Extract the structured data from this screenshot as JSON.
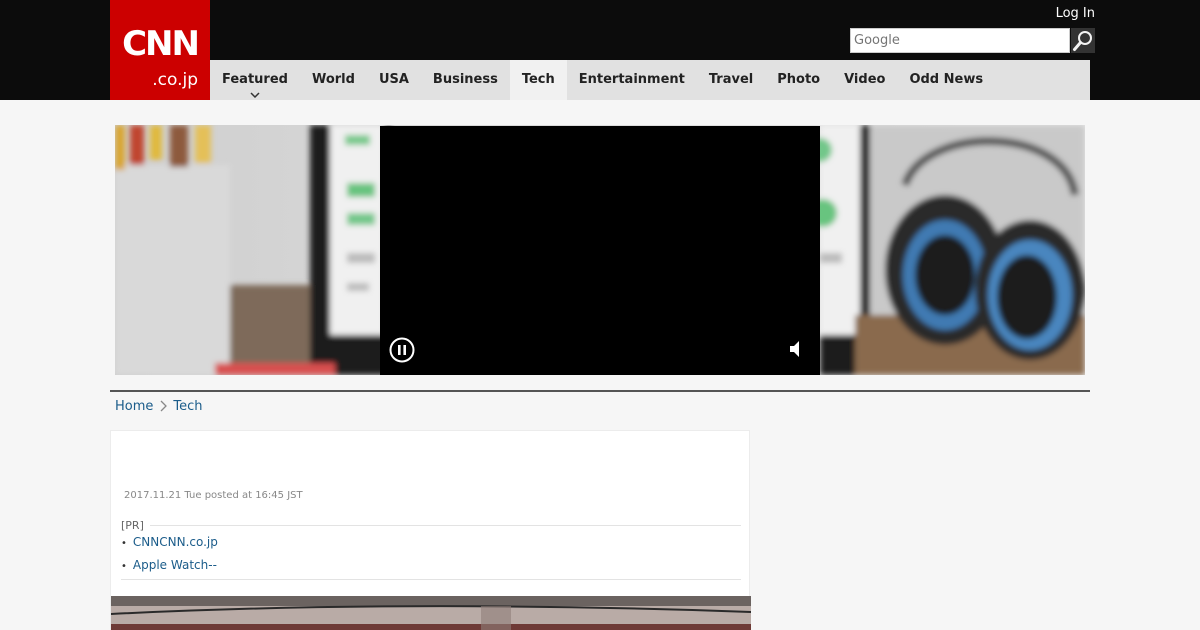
{
  "site": {
    "logo_main": "CNN",
    "logo_sub": ".co.jp"
  },
  "header": {
    "login_label": "Log In",
    "search_placeholder": "Google"
  },
  "nav": {
    "items": [
      {
        "label": "Featured"
      },
      {
        "label": "World"
      },
      {
        "label": "USA"
      },
      {
        "label": "Business"
      },
      {
        "label": "Tech"
      },
      {
        "label": "Entertainment"
      },
      {
        "label": "Travel"
      },
      {
        "label": "Photo"
      },
      {
        "label": "Video"
      },
      {
        "label": "Odd News"
      }
    ],
    "active": "Tech"
  },
  "breadcrumb": {
    "home": "Home",
    "current": "Tech"
  },
  "article": {
    "posted": "2017.11.21 Tue posted at 16:45 JST"
  },
  "pr": {
    "label": "[PR]",
    "links": [
      {
        "text": "CNNCNN.co.jp"
      },
      {
        "text": "Apple Watch--"
      }
    ]
  },
  "colors": {
    "brand_red": "#cc0000",
    "topbar": "#0c0c0c",
    "nav_bg": "#e1e1e1",
    "link": "#1b5c8a"
  },
  "icons": [
    "search-icon",
    "chevron-down-icon",
    "chevron-right-icon",
    "pause-icon",
    "speaker-icon"
  ]
}
